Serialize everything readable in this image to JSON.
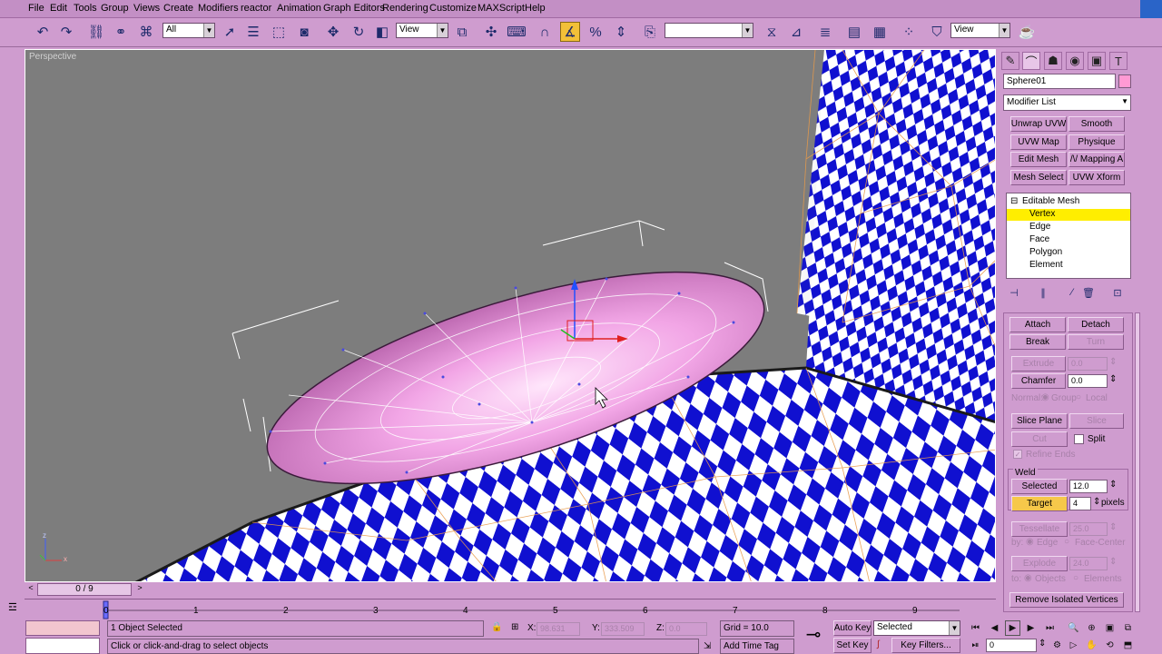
{
  "menu": [
    "File",
    "Edit",
    "Tools",
    "Group",
    "Views",
    "Create",
    "Modifiers",
    "reactor",
    "Animation",
    "Graph Editors",
    "Rendering",
    "Customize",
    "MAXScript",
    "Help"
  ],
  "toolbar": {
    "selection_filter": "All",
    "ref_coord": "View",
    "named_selection": "",
    "ref_coord2": "View",
    "icons": [
      "undo-icon",
      "redo-icon",
      "select-link-icon",
      "unlink-icon",
      "bind-spacewarp-icon",
      "select-object-icon",
      "select-by-name-icon",
      "rect-selection-icon",
      "window-crossing-icon",
      "move-icon",
      "rotate-icon",
      "scale-icon",
      "pivot-center-icon",
      "manipulate-icon",
      "keyboard-shortcut-icon",
      "snap-3d-icon",
      "angle-snap-icon",
      "percent-snap-icon",
      "spinner-snap-icon",
      "edit-named-selection-icon",
      "mirror-icon",
      "align-icon",
      "layer-manager-icon",
      "curve-editor-icon",
      "schematic-view-icon",
      "material-editor-icon",
      "render-scene-icon",
      "quick-render-icon"
    ]
  },
  "viewport": {
    "label": "Perspective",
    "axis_z": "z",
    "axis_x": "x"
  },
  "panel": {
    "object_name": "Sphere01",
    "object_color": "#ff9ad4",
    "modifier_list": "Modifier List",
    "modifier_buttons": [
      "Unwrap UVW",
      "Smooth",
      "UVW Map",
      "Physique",
      "Edit Mesh",
      "/\\/ Mapping A",
      "Mesh Select",
      "UVW Xform"
    ],
    "stack": {
      "root": "Editable Mesh",
      "items": [
        "Vertex",
        "Edge",
        "Face",
        "Polygon",
        "Element"
      ],
      "selected": "Vertex"
    },
    "edit_geometry": {
      "attach": "Attach",
      "detach": "Detach",
      "break": "Break",
      "turn": "Turn",
      "extrude": "Extrude",
      "extrude_val": "0.0",
      "chamfer": "Chamfer",
      "chamfer_val": "0.0",
      "normal": "Normal:",
      "group": "Group",
      "local": "Local",
      "slice_plane": "Slice Plane",
      "slice": "Slice",
      "cut": "Cut",
      "split": "Split",
      "refine_ends": "Refine Ends",
      "weld_title": "Weld",
      "selected": "Selected",
      "selected_val": "12.0",
      "target": "Target",
      "target_val": "4",
      "pixels": "pixels",
      "tessellate": "Tessellate",
      "tess_val": "25.0",
      "by": "by:",
      "edge": "Edge",
      "face_center": "Face-Center",
      "explode": "Explode",
      "explode_val": "24.0",
      "to": "to:",
      "objects": "Objects",
      "elements": "Elements",
      "remove_isolated": "Remove Isolated Vertices"
    }
  },
  "timeline": {
    "frame": "0 / 9",
    "ticks": [
      "0",
      "1",
      "2",
      "3",
      "4",
      "5",
      "6",
      "7",
      "8",
      "9"
    ]
  },
  "status": {
    "selected": "1 Object Selected",
    "prompt": "Click or click-and-drag to select objects",
    "x_label": "X:",
    "x_val": "98.631",
    "y_label": "Y:",
    "y_val": "333.509",
    "z_label": "Z:",
    "z_val": "0.0",
    "grid": "Grid = 10.0",
    "add_time_tag": "Add Time Tag",
    "auto_key": "Auto Key",
    "set_key": "Set Key",
    "key_mode": "Selected",
    "key_filters": "Key Filters...",
    "current_frame": "0"
  }
}
